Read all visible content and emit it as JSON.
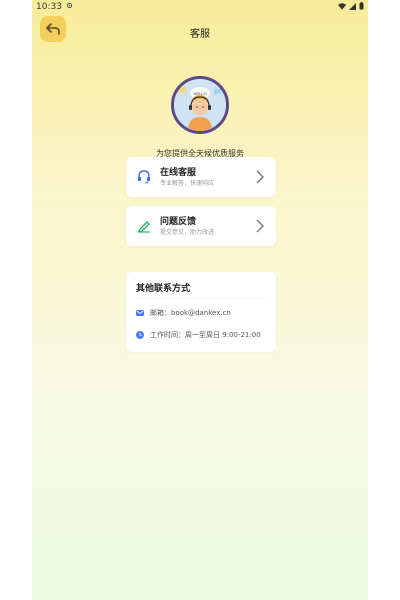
{
  "status_bar": {
    "time": "10:33",
    "notification_icon": "settings-gear",
    "right_icons": [
      "wifi",
      "signal",
      "battery"
    ]
  },
  "header": {
    "title": "客服",
    "back_icon": "back-arrow"
  },
  "tagline": "为您提供全天候优质服务",
  "avatar": {
    "icon": "customer-service-agent",
    "bubble_text": "HELLO"
  },
  "menu": [
    {
      "title": "在线客服",
      "subtitle": "专业解答，快速响应",
      "icon": "headset",
      "icon_color": "#3f6df0"
    },
    {
      "title": "问题反馈",
      "subtitle": "提交意见，助力改进",
      "icon": "pencil",
      "icon_color": "#2eb06b"
    }
  ],
  "contact": {
    "title": "其他联系方式",
    "email": "邮箱：book@dankex.cn",
    "hours": "工作时间：周一至周日 9:00-21:00",
    "accent_color": "#4f7cf5"
  }
}
